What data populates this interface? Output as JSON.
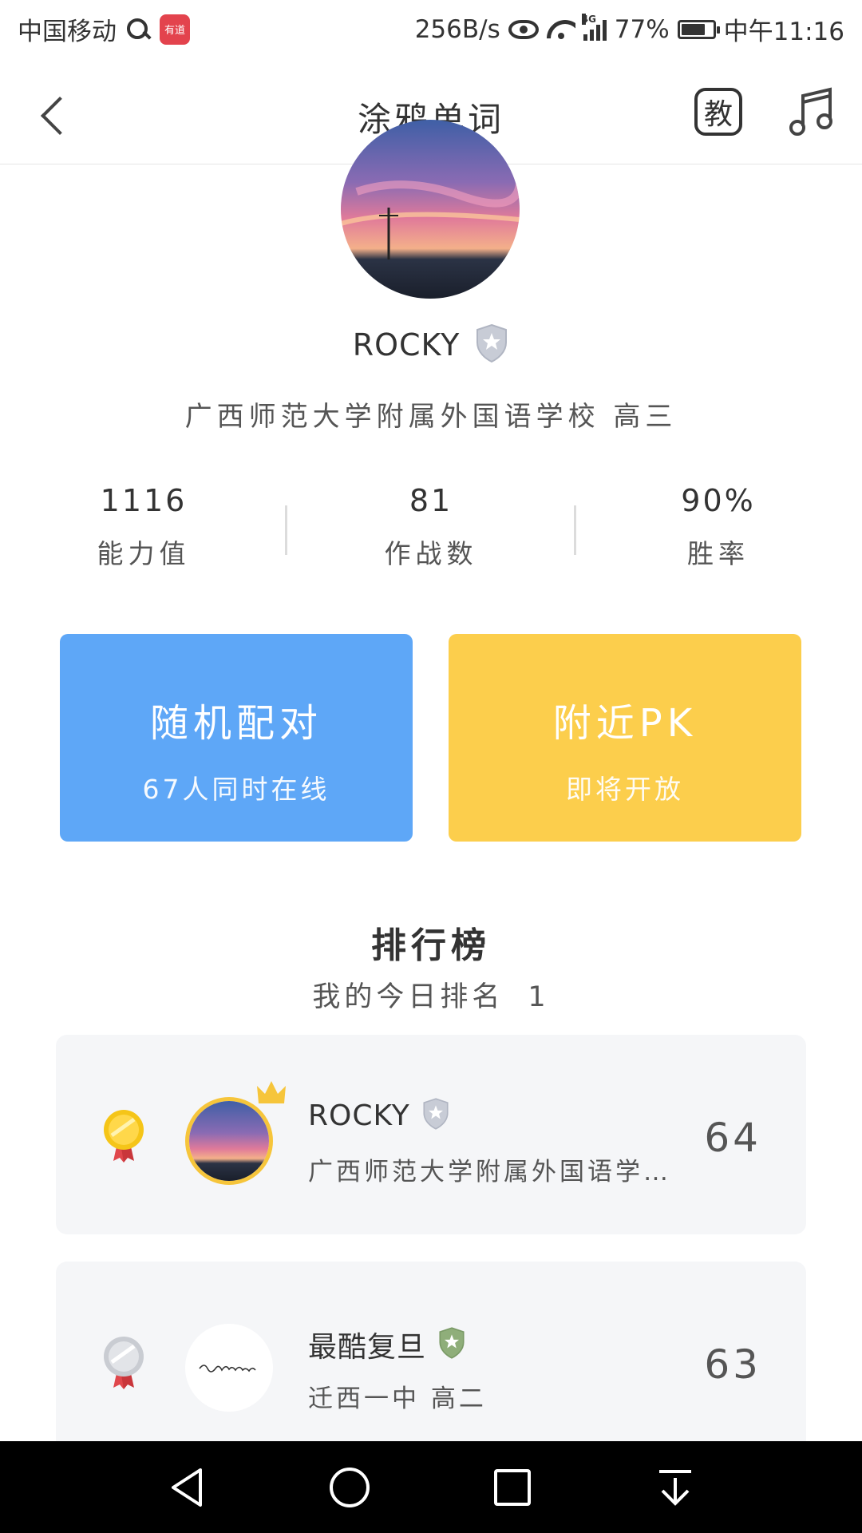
{
  "status_bar": {
    "carrier": "中国移动",
    "app_badge": "有道",
    "net_speed": "256B/s",
    "network_type": "4G",
    "battery": "77%",
    "time": "中午11:16"
  },
  "header": {
    "title": "涂鸦单词",
    "teach_label": "教",
    "back_icon": "chevron-left-icon",
    "music_icon": "music-note-icon"
  },
  "profile": {
    "username": "ROCKY",
    "school": "广西师范大学附属外国语学校 高三",
    "stats": [
      {
        "value": "1116",
        "label": "能力值"
      },
      {
        "value": "81",
        "label": "作战数"
      },
      {
        "value": "90%",
        "label": "胜率"
      }
    ]
  },
  "actions": {
    "random": {
      "title": "随机配对",
      "subtitle": "67人同时在线",
      "color": "#5ea7f7"
    },
    "nearby": {
      "title": "附近PK",
      "subtitle": "即将开放",
      "color": "#fcce4c"
    }
  },
  "leaderboard": {
    "title": "排行榜",
    "my_rank_label": "我的今日排名",
    "my_rank_value": "1",
    "entries": [
      {
        "medal": "gold",
        "name": "ROCKY",
        "school": "广西师范大学附属外国语学…",
        "score": "64"
      },
      {
        "medal": "silver",
        "name": "最酷复旦",
        "school": "迁西一中 高二",
        "score": "63"
      }
    ]
  },
  "nav_bar": {
    "back": "triangle-back-icon",
    "home": "circle-home-icon",
    "recents": "square-recents-icon",
    "notifications": "pull-down-icon"
  }
}
